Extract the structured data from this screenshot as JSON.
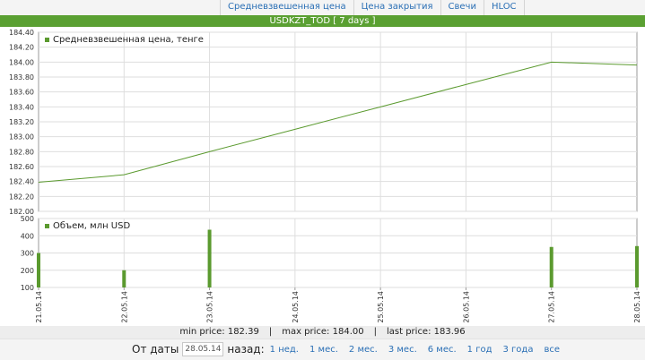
{
  "nav": {
    "tabs": [
      {
        "label": "Средневзвешенная цена"
      },
      {
        "label": "Цена закрытия"
      },
      {
        "label": "Свечи"
      },
      {
        "label": "HLOC"
      }
    ]
  },
  "header": {
    "title": "USDKZT_TOD [ 7 days ]"
  },
  "chart_data": {
    "type": "line",
    "x": [
      "21.05.14",
      "22.05.14",
      "23.05.14",
      "24.05.14",
      "25.05.14",
      "26.05.14",
      "27.05.14",
      "28.05.14"
    ],
    "colors": {
      "series": "#5b9a2f"
    },
    "price": {
      "legend": "Средневзвешенная цена, тенге",
      "values": [
        182.39,
        182.49,
        182.8,
        183.1,
        183.4,
        183.7,
        184.0,
        183.96
      ],
      "ylim": [
        182.0,
        184.4
      ],
      "yticks": [
        "182.00",
        "182.20",
        "182.40",
        "182.60",
        "182.80",
        "183.00",
        "183.20",
        "183.40",
        "183.60",
        "183.80",
        "184.00",
        "184.20",
        "184.40"
      ]
    },
    "volume": {
      "type": "bar",
      "legend": "Объем, млн USD",
      "values": [
        300,
        200,
        435,
        100,
        100,
        100,
        335,
        340
      ],
      "ylim": [
        100,
        500
      ],
      "yticks": [
        "100",
        "200",
        "300",
        "400",
        "500"
      ]
    },
    "grid": true,
    "legend_position": "top-left"
  },
  "stats": {
    "min": "min price: 182.39",
    "max": "max price: 184.00",
    "last": "last price: 183.96",
    "separator": "|"
  },
  "filter": {
    "from_label": "От даты",
    "date_value": "28.05.14",
    "back_label": "назад:",
    "periods": [
      "1 нед.",
      "1 мес.",
      "2 мес.",
      "3 мес.",
      "6 мес.",
      "1 год",
      "3 года",
      "все"
    ]
  }
}
